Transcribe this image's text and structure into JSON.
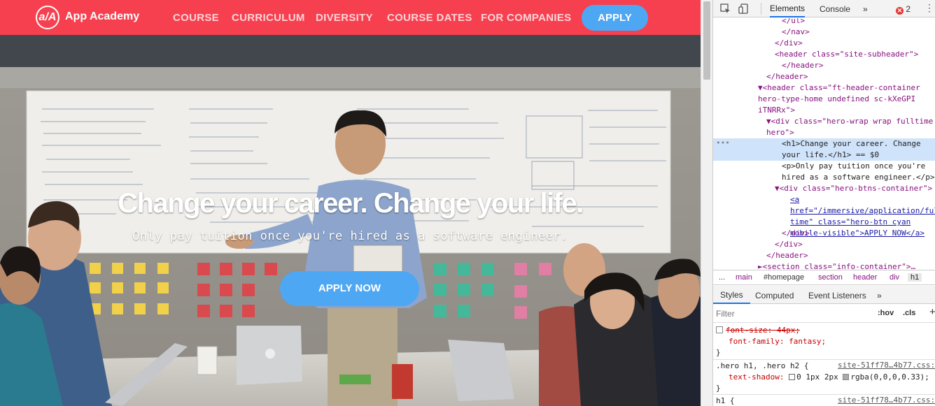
{
  "brand": {
    "logo_mark": "a/A",
    "name": "App Academy"
  },
  "nav": {
    "links": [
      "COURSE",
      "CURRICULUM",
      "DIVERSITY",
      "COURSE DATES",
      "FOR COMPANIES"
    ],
    "apply": "APPLY"
  },
  "hero": {
    "title": "Change your career. Change your life.",
    "subtitle": "Only pay tuition once you're hired as a software engineer.",
    "cta": "APPLY NOW"
  },
  "devtools": {
    "tabs": [
      "Elements",
      "Console"
    ],
    "more_tabs": "»",
    "error_count": "2",
    "dom": [
      {
        "indent": 8,
        "text": "</ul>"
      },
      {
        "indent": 7,
        "text": "</nav>"
      },
      {
        "indent": 6,
        "text": "</div>"
      },
      {
        "indent": 6,
        "text": "<header class=\"site-subheader\">"
      },
      {
        "indent": 6,
        "text": "</header>"
      },
      {
        "indent": 5,
        "text": "</header>"
      },
      {
        "indent": 4,
        "text": "▼<header class=\"ft-header-container hero-type-home undefined sc-kXeGPI iTNRRx\">"
      },
      {
        "indent": 5,
        "text": "▼<div class=\"hero-wrap wrap fulltime hero\">"
      },
      {
        "indent": 7,
        "text": "<h1>Change your career. Change your life.</h1> == $0"
      },
      {
        "indent": 7,
        "text": "<p>Only pay tuition once you're hired as a software engineer.</p>"
      },
      {
        "indent": 6,
        "text": "▼<div class=\"hero-btns-container\">"
      },
      {
        "indent": 8,
        "text": "<a href=\"/immersive/application/full-time\" class=\"hero-btn cyan mobile-visible\">APPLY NOW</a>"
      },
      {
        "indent": 7,
        "text": "</div>"
      },
      {
        "indent": 6,
        "text": "</div>"
      },
      {
        "indent": 5,
        "text": "</header>"
      },
      {
        "indent": 4,
        "text": "►<section class=\"info-container\">…"
      }
    ],
    "breadcrumb": [
      "...",
      "main",
      "#homepage",
      "section",
      "header",
      "div",
      "h1"
    ],
    "subtabs": [
      "Styles",
      "Computed",
      "Event Listeners",
      "»"
    ],
    "filter_placeholder": "Filter",
    "hov": ":hov",
    "cls": ".cls",
    "plus": "+",
    "rules": {
      "r1_prop1": "font-size: 44px;",
      "r1_prop2": "font-family: fantasy;",
      "r2_selector": ".hero h1, .hero h2 {",
      "r2_source": "site-51ff78…4b77.css:",
      "r2_prop": "text-shadow:",
      "r2_value": "0 1px 2px",
      "r2_color": "rgba(0,0,0,0.33);",
      "r3_selector": "h1 {",
      "r3_source": "site-51ff78…4b77.css:"
    }
  }
}
